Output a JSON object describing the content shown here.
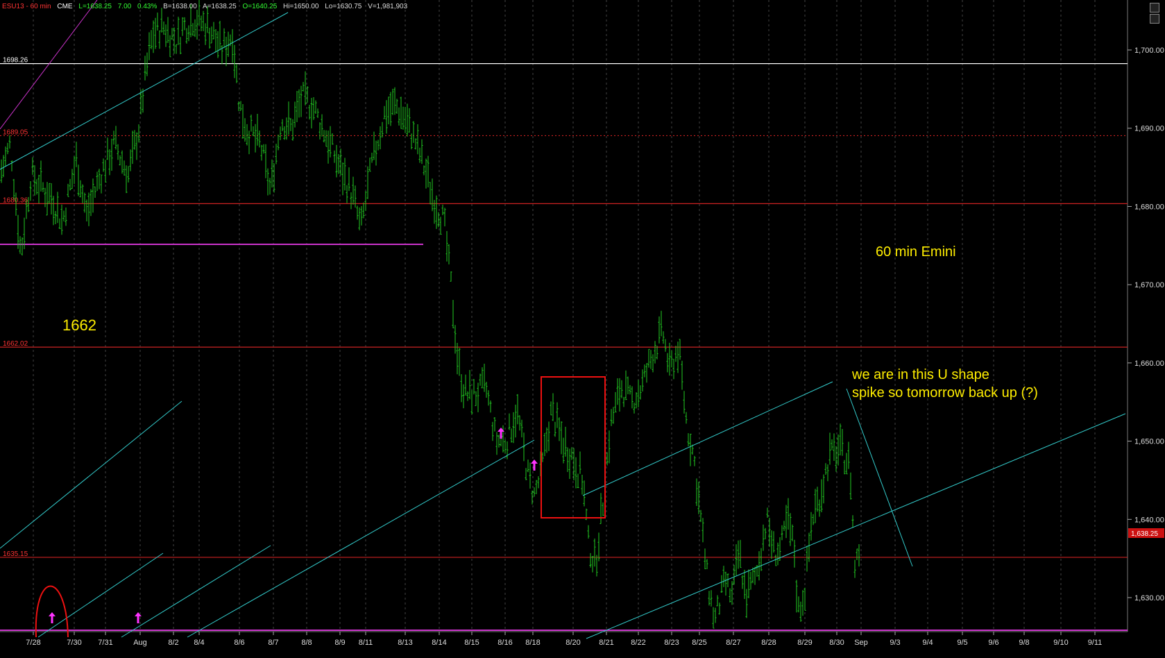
{
  "header": {
    "symbol": "ESU13 - 60 min",
    "exchange": "CME",
    "last": "L=1638.25",
    "change": "7.00",
    "pct": "0.43%",
    "bid": "B=1638.00",
    "ask": "A=1638.25",
    "open": "O=1640.25",
    "high": "Hi=1650.00",
    "low": "Lo=1630.75",
    "volume": "V=1,981,903"
  },
  "colors": {
    "background": "#000000",
    "bars": "#22cc22",
    "grid": "#444444",
    "support": "#cc2222",
    "trend": "#33cccc",
    "magenta": "#cc33cc",
    "annotation": "#ffee00",
    "white_line": "#ffffff"
  },
  "chart_data": {
    "type": "bar",
    "title": "",
    "xlabel": "",
    "ylabel": "",
    "ylim": [
      1625,
      1706
    ],
    "grid": true,
    "x_tick_labels": [
      "7/28",
      "7/30",
      "7/31",
      "Aug",
      "8/2",
      "8/4",
      "8/6",
      "8/7",
      "8/8",
      "8/9",
      "8/11",
      "8/13",
      "8/14",
      "8/15",
      "8/16",
      "8/18",
      "8/20",
      "8/21",
      "8/22",
      "8/23",
      "8/25",
      "8/27",
      "8/28",
      "8/29",
      "8/30",
      "Sep",
      "9/3",
      "9/4",
      "9/5",
      "9/6",
      "9/8",
      "9/10",
      "9/11"
    ],
    "y_ticks": [
      "1,700.00",
      "1,690.00",
      "1,680.00",
      "1,670.00",
      "1,660.00",
      "1,650.00",
      "1,640.00",
      "1,630.00"
    ],
    "last_price_label": "1,638.25",
    "horizontal_levels": [
      {
        "label": "1698.26",
        "value": 1698.26,
        "color": "white"
      },
      {
        "label": "1689.05",
        "value": 1689.05,
        "color": "red-dashed"
      },
      {
        "label": "1680.36",
        "value": 1680.36,
        "color": "red"
      },
      {
        "label": "1662.02",
        "value": 1662.02,
        "color": "red"
      },
      {
        "label": "1635.15",
        "value": 1635.15,
        "color": "red"
      }
    ],
    "annotations": [
      {
        "text": "60 min Emini"
      },
      {
        "text": "1662"
      },
      {
        "text": "we are in this U shape"
      },
      {
        "text": "spike so tomorrow back up (?)"
      }
    ],
    "price_path": [
      [
        0,
        1684
      ],
      [
        15,
        1688
      ],
      [
        30,
        1674
      ],
      [
        45,
        1684
      ],
      [
        75,
        1681
      ],
      [
        90,
        1678
      ],
      [
        110,
        1686
      ],
      [
        125,
        1679
      ],
      [
        145,
        1684
      ],
      [
        165,
        1688
      ],
      [
        185,
        1684
      ],
      [
        200,
        1690
      ],
      [
        210,
        1697
      ],
      [
        220,
        1702
      ],
      [
        235,
        1703
      ],
      [
        255,
        1701
      ],
      [
        265,
        1703
      ],
      [
        280,
        1704
      ],
      [
        300,
        1703
      ],
      [
        320,
        1700
      ],
      [
        335,
        1702
      ],
      [
        345,
        1693
      ],
      [
        355,
        1690
      ],
      [
        375,
        1688
      ],
      [
        390,
        1682
      ],
      [
        405,
        1691
      ],
      [
        420,
        1690
      ],
      [
        435,
        1694
      ],
      [
        450,
        1693
      ],
      [
        465,
        1690
      ],
      [
        480,
        1687
      ],
      [
        495,
        1684
      ],
      [
        510,
        1681
      ],
      [
        520,
        1677
      ],
      [
        535,
        1685
      ],
      [
        555,
        1692
      ],
      [
        570,
        1693
      ],
      [
        585,
        1691
      ],
      [
        600,
        1688
      ],
      [
        615,
        1684
      ],
      [
        625,
        1681
      ],
      [
        640,
        1678
      ],
      [
        650,
        1670
      ],
      [
        660,
        1660
      ],
      [
        670,
        1656
      ],
      [
        685,
        1656
      ],
      [
        700,
        1657
      ],
      [
        715,
        1650
      ],
      [
        730,
        1650
      ],
      [
        745,
        1654
      ],
      [
        760,
        1646
      ],
      [
        770,
        1643
      ],
      [
        780,
        1646
      ],
      [
        795,
        1654
      ],
      [
        810,
        1650
      ],
      [
        825,
        1648
      ],
      [
        840,
        1645
      ],
      [
        848,
        1637
      ],
      [
        858,
        1634
      ],
      [
        870,
        1643
      ],
      [
        880,
        1652
      ],
      [
        895,
        1657
      ],
      [
        910,
        1655
      ],
      [
        925,
        1657
      ],
      [
        940,
        1661
      ],
      [
        955,
        1664
      ],
      [
        965,
        1659
      ],
      [
        978,
        1662
      ],
      [
        990,
        1652
      ],
      [
        1000,
        1648
      ],
      [
        1010,
        1640
      ],
      [
        1020,
        1632
      ],
      [
        1030,
        1627
      ],
      [
        1045,
        1632
      ],
      [
        1055,
        1630
      ],
      [
        1065,
        1636
      ],
      [
        1075,
        1630
      ],
      [
        1090,
        1633
      ],
      [
        1105,
        1640
      ],
      [
        1115,
        1636
      ],
      [
        1125,
        1636
      ],
      [
        1135,
        1640
      ],
      [
        1145,
        1636
      ],
      [
        1150,
        1628
      ],
      [
        1160,
        1631
      ],
      [
        1170,
        1640
      ],
      [
        1185,
        1644
      ],
      [
        1195,
        1648
      ],
      [
        1210,
        1649
      ],
      [
        1225,
        1647
      ],
      [
        1232,
        1634
      ],
      [
        1238,
        1636
      ]
    ]
  }
}
